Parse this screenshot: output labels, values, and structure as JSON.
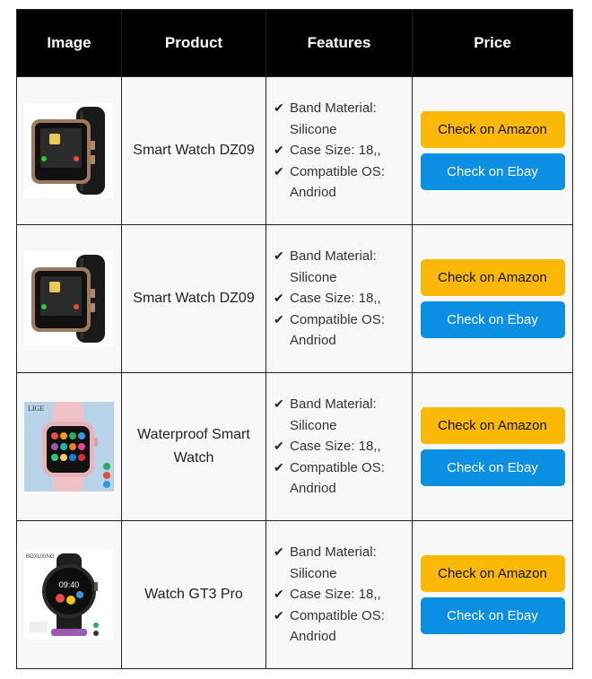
{
  "table": {
    "headers": [
      "Image",
      "Product",
      "Features",
      "Price"
    ],
    "rows": [
      {
        "product": "Smart Watch DZ09",
        "image_icon": "smartwatch-dz09-gold",
        "features": [
          "Band Material: Silicone",
          "Case Size: 18,,",
          "Compatible OS: Andriod"
        ],
        "amazon_label": "Check on Amazon",
        "ebay_label": "Check on Ebay"
      },
      {
        "product": "Smart Watch DZ09",
        "image_icon": "smartwatch-dz09-gold",
        "features": [
          "Band Material: Silicone",
          "Case Size: 18,,",
          "Compatible OS: Andriod"
        ],
        "amazon_label": "Check on Amazon",
        "ebay_label": "Check on Ebay"
      },
      {
        "product": "Waterproof Smart Watch",
        "image_icon": "smartwatch-pink",
        "image_brand": "LIGE",
        "features": [
          "Band Material: Silicone",
          "Case Size: 18,,",
          "Compatible OS: Andriod"
        ],
        "amazon_label": "Check on Amazon",
        "ebay_label": "Check on Ebay"
      },
      {
        "product": "Watch GT3 Pro",
        "image_icon": "smartwatch-round-black",
        "image_brand": "BOXUXING",
        "image_time": "09:40",
        "features": [
          "Band Material: Silicone",
          "Case Size: 18,,",
          "Compatible OS: Andriod"
        ],
        "amazon_label": "Check on Amazon",
        "ebay_label": "Check on Ebay"
      }
    ]
  },
  "colors": {
    "header_bg": "#000000",
    "amazon_button": "#fcb807",
    "ebay_button": "#0a8fe2",
    "row_bg": "#f8f8f8"
  }
}
